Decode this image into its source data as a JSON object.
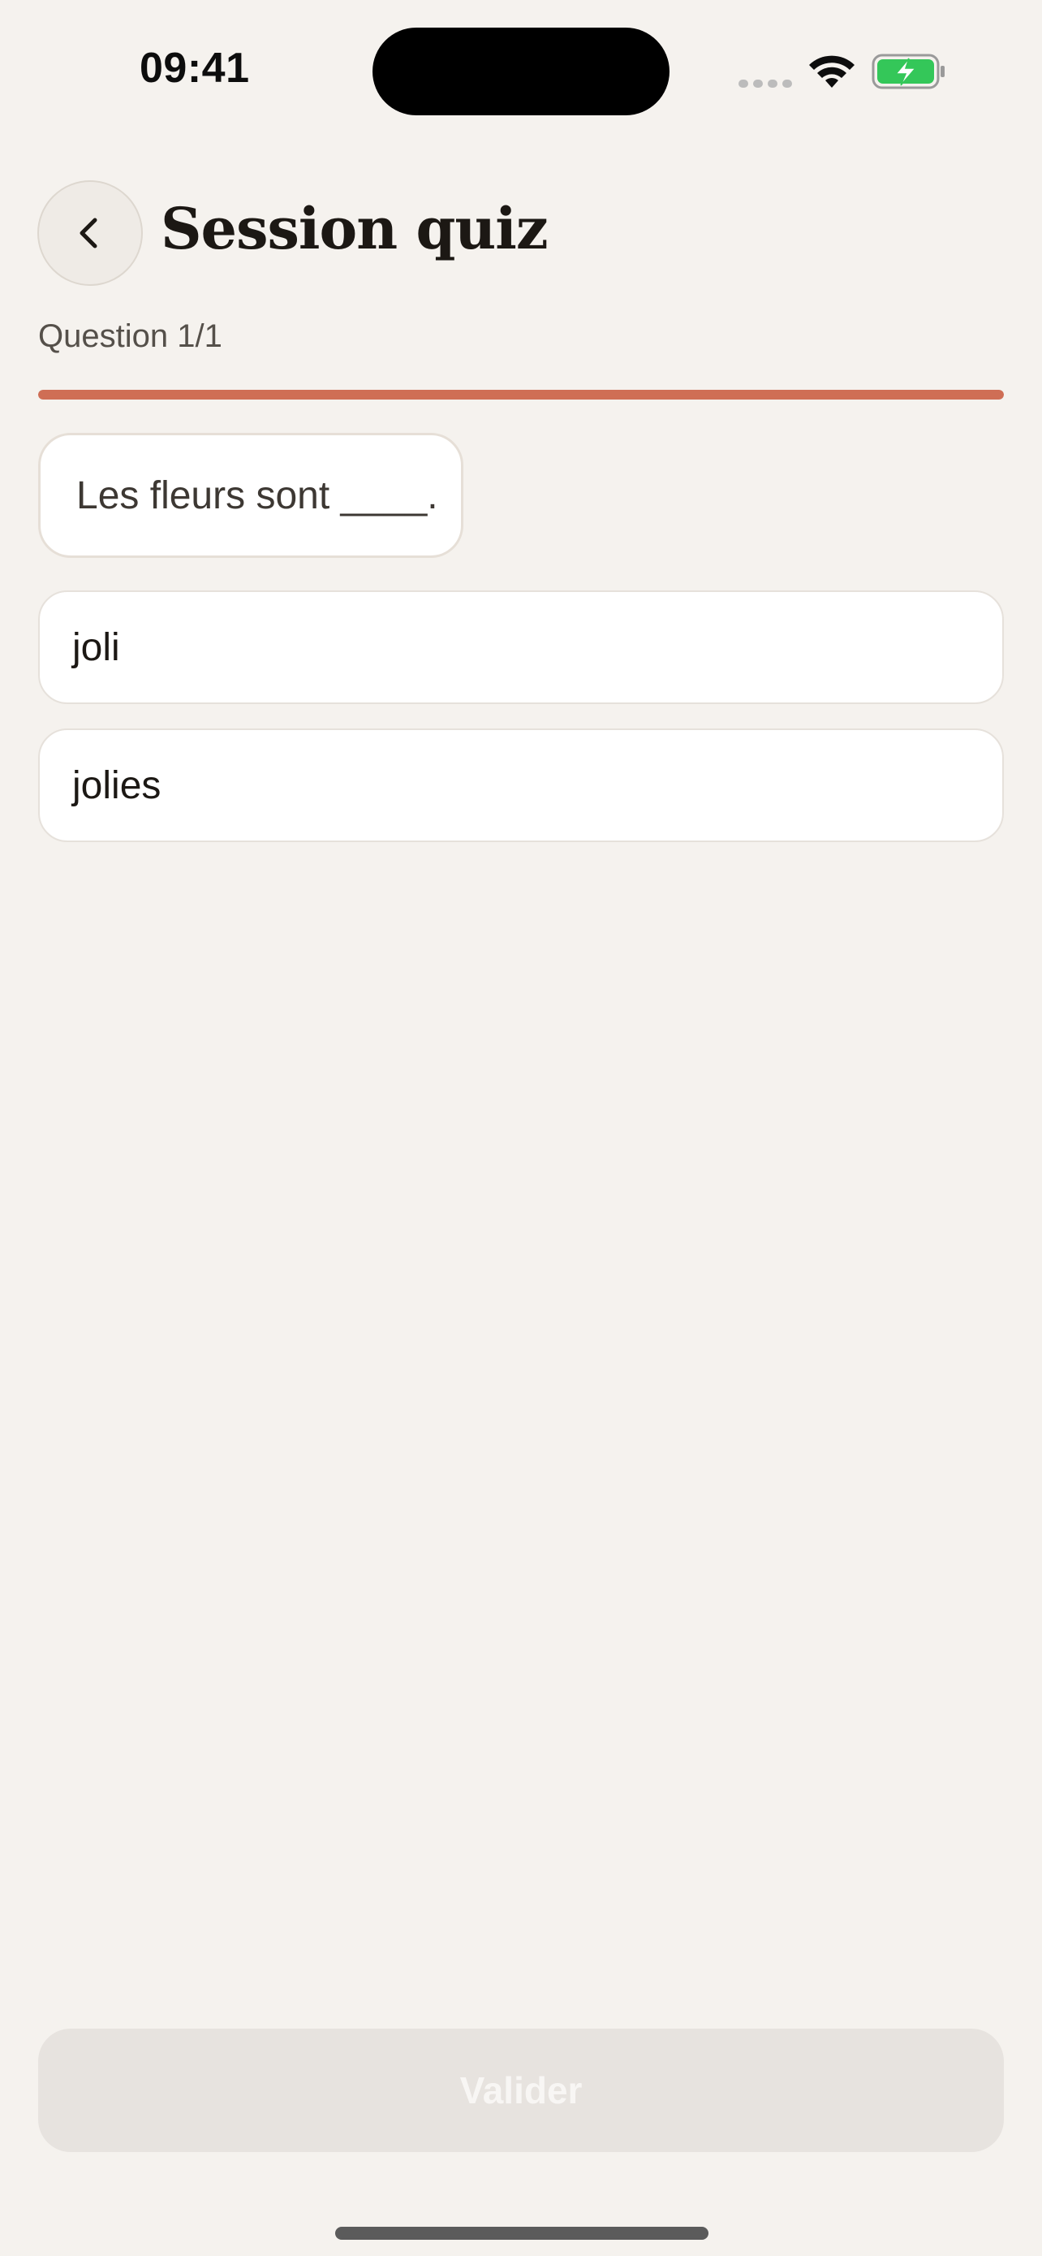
{
  "status_bar": {
    "time": "09:41",
    "icons": [
      "signal-dots-icon",
      "wifi-icon",
      "battery-charging-icon"
    ]
  },
  "header": {
    "back_icon": "chevron-left-icon",
    "title": "Session quiz"
  },
  "quiz": {
    "counter": "Question 1/1",
    "progress_percent": 100,
    "prompt": "Les fleurs sont ____.",
    "options": [
      {
        "label": "joli"
      },
      {
        "label": "jolies"
      }
    ]
  },
  "footer": {
    "submit_label": "Valider",
    "submit_enabled": false
  },
  "colors": {
    "accent": "#cf6e55",
    "background": "#f5f2ee",
    "battery_green": "#34c759"
  }
}
